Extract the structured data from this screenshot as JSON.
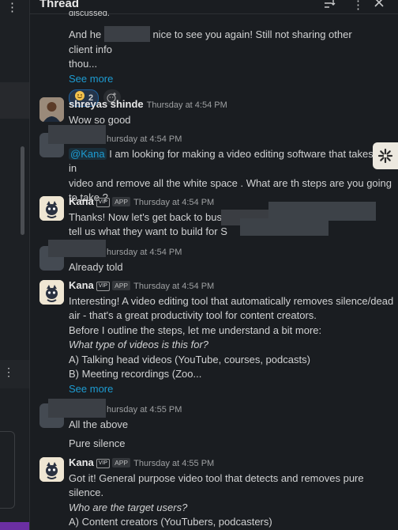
{
  "header": {
    "title": "Thread"
  },
  "messages": {
    "m0": {
      "partial_top": "discussed.",
      "line1_pre": "And he",
      "line1_post": "nice to see you again! Still not sharing other client info",
      "line2": "thou...",
      "see_more": "See more",
      "reaction_count": "2",
      "reaction_icon": "smile-emoji"
    },
    "m1": {
      "name": "shreyas shinde",
      "time": "Thursday at 4:54 PM",
      "text": "Wow so good"
    },
    "m2": {
      "time": "hursday at 4:54 PM",
      "mention": "@Kana",
      "line1": "I am looking for making a video editing software that takes in",
      "line2": "video and remove all the white space . What are th steps are you going",
      "line3": "to take ?"
    },
    "m3": {
      "name": "Kana",
      "badge": "VIP",
      "app": "APP",
      "time": "Thursday at 4:54 PM",
      "line1": "Thanks! Now let's get back to busir",
      "line2": "tell us what they want to build for S"
    },
    "m4": {
      "time": "hursday at 4:54 PM",
      "text": "Already told"
    },
    "m5": {
      "name": "Kana",
      "badge": "VIP",
      "app": "APP",
      "time": "Thursday at 4:54 PM",
      "line1": "Interesting! A video editing tool that automatically removes silence/dead",
      "line2": "air - that's a great productivity tool for content creators.",
      "line3": "Before I outline the steps, let me understand a bit more:",
      "line4": "What type of videos is this for?",
      "line5": "A) Talking head videos (YouTube, courses, podcasts)",
      "line6": "B) Meeting recordings (Zoo...",
      "see_more": "See more"
    },
    "m6": {
      "time": "hursday at 4:55 PM",
      "line1": "All the above",
      "line2": "Pure silence"
    },
    "m7": {
      "name": "Kana",
      "badge": "VIP",
      "app": "APP",
      "time": "Thursday at 4:55 PM",
      "line1": "Got it! General purpose video tool that detects and removes pure",
      "line2": "silence.",
      "line3": "Who are the target users?",
      "line4": "A) Content creators (YouTubers, podcasters)"
    }
  },
  "colors": {
    "background": "#1a1d21",
    "link": "#1d9bd1",
    "accent_bar": "#6b2fa3"
  }
}
